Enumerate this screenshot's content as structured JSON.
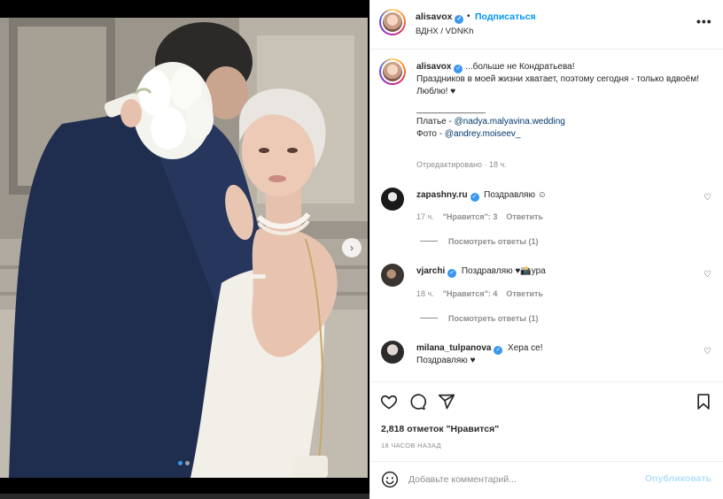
{
  "post": {
    "username": "alisavox",
    "verified_mark": "✓",
    "separator": "•",
    "follow_label": "Подписаться",
    "location": "ВДНХ / VDNKh",
    "more_label": "•••",
    "carousel": {
      "next_glyph": "›",
      "slide_count": 2,
      "active_slide": 1
    }
  },
  "caption": {
    "username": "alisavox",
    "line1": "...больше не Кондратьева!",
    "line2": "Праздников в моей жизни хватает, поэтому сегодня - только вдвоём!",
    "line3": "Люблю! ♥",
    "divider": "______________",
    "dress_prefix": "Платье - ",
    "dress_link": "@nadya.malyavina.wedding",
    "photo_prefix": "Фото - ",
    "photo_link": "@andrey.moiseev_",
    "edited": "Отредактировано · 18 ч."
  },
  "comments": [
    {
      "username": "zapashny.ru",
      "text": "Поздравляю ☺",
      "time": "17 ч.",
      "likes": "\"Нравится\": 3",
      "reply": "Ответить",
      "view_replies": "Посмотреть ответы (1)"
    },
    {
      "username": "vjarchi",
      "text": "Поздравляю ♥📸ура",
      "time": "18 ч.",
      "likes": "\"Нравится\": 4",
      "reply": "Ответить",
      "view_replies": "Посмотреть ответы (1)"
    },
    {
      "username": "milana_tulpanova",
      "text": "Хера се!",
      "text2": "Поздравляю ♥"
    }
  ],
  "actions": {
    "like_icon": "heart-outline",
    "comment_icon": "comment-bubble",
    "share_icon": "paper-plane",
    "save_icon": "bookmark",
    "likes_count": "2,818 отметок \"Нравится\"",
    "time_ago": "18 ЧАСОВ НАЗАД"
  },
  "comment_box": {
    "placeholder": "Добавьте комментарий...",
    "publish_label": "Опубликовать"
  },
  "colors": {
    "accent": "#0095f6",
    "verified": "#3897f0",
    "publish_disabled": "#b2dffc",
    "link": "#00376b",
    "muted": "#8e8e8e"
  }
}
